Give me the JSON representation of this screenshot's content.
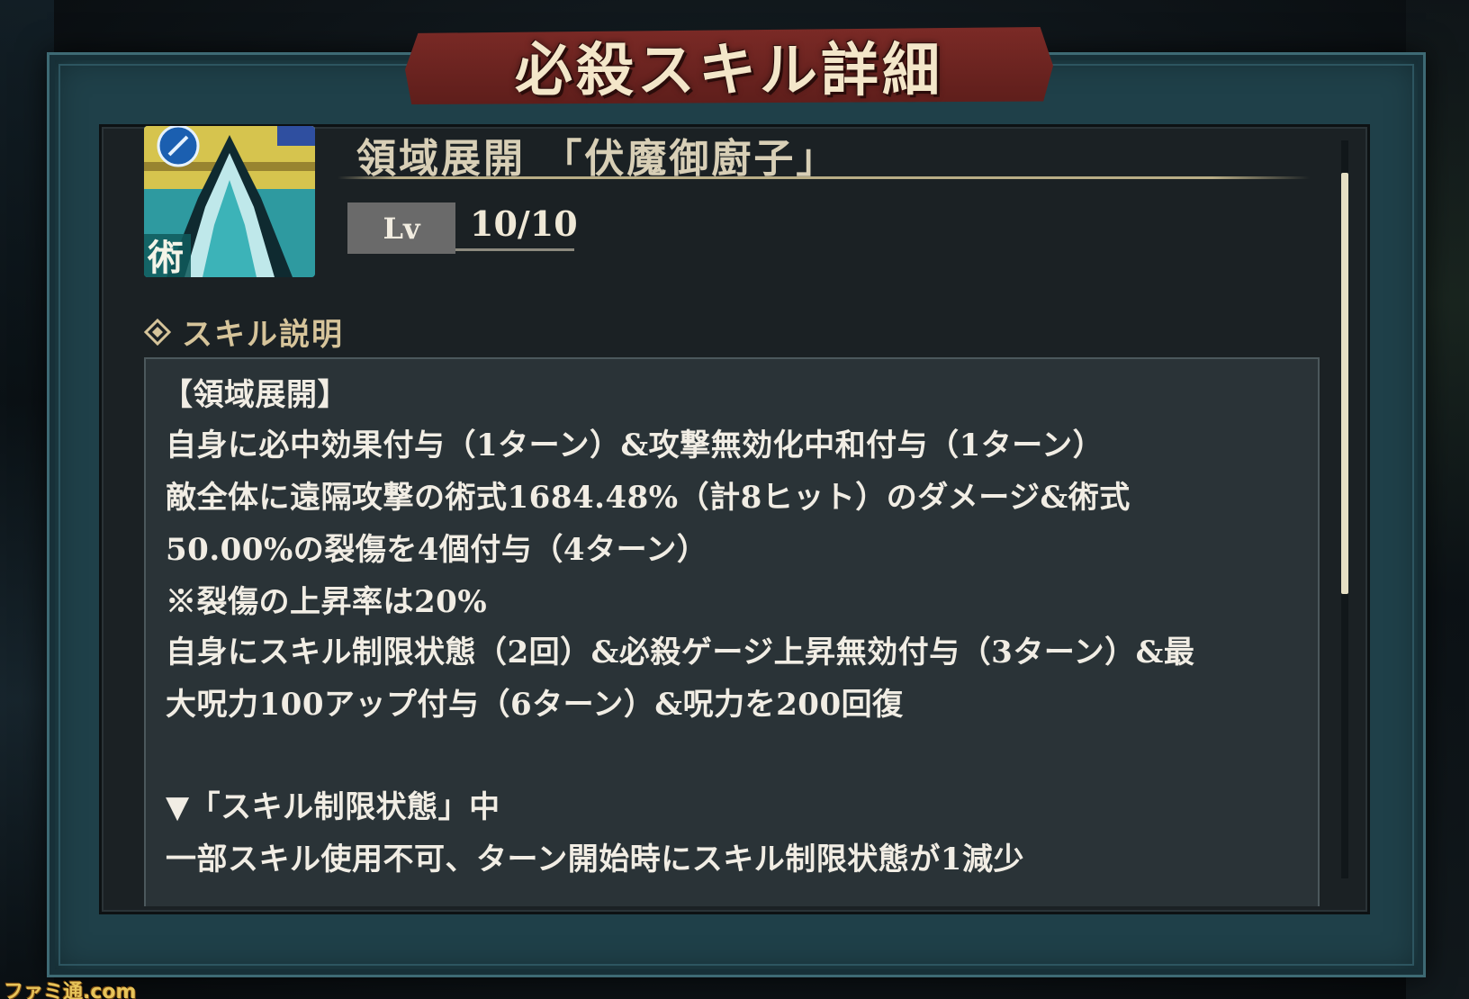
{
  "dialog": {
    "title": "必殺スキル詳細"
  },
  "skill": {
    "icon": "domain-expansion-skill-icon",
    "icon_badge": "術",
    "name": "領域展開 「伏魔御廚子」",
    "level_label": "Lv",
    "level_value": "10/10"
  },
  "description": {
    "section_label": "スキル説明",
    "lines": [
      "【領域展開】",
      "自身に必中効果付与（1ターン）&攻撃無効化中和付与（1ターン）",
      "敵全体に遠隔攻撃の術式1684.48%（計8ヒット）のダメージ&術式",
      "50.00%の裂傷を4個付与（4ターン）",
      "※裂傷の上昇率は20%",
      "自身にスキル制限状態（2回）&必殺ゲージ上昇無効付与（3ターン）&最",
      "大呪力100アップ付与（6ターン）&呪力を200回復",
      "",
      "▼「スキル制限状態」中",
      "一部スキル使用不可、ターン開始時にスキル制限状態が1減少"
    ]
  },
  "watermark": "ファミ通.com",
  "colors": {
    "frame": "#1f4049",
    "banner": "#6e2421",
    "panel": "#2a3337",
    "accent_gold": "#d6c49a"
  }
}
